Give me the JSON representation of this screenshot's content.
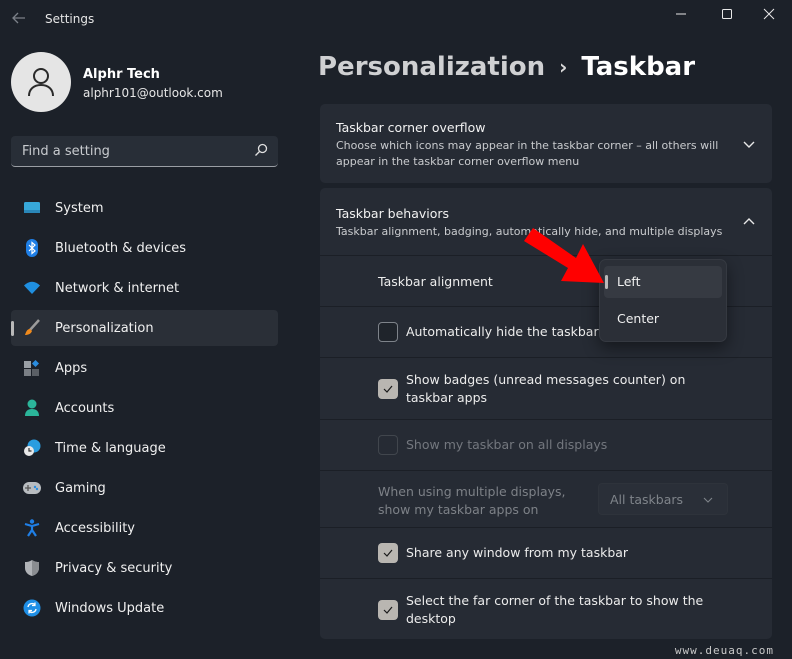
{
  "window": {
    "title": "Settings",
    "back_icon": "arrow-left",
    "controls": [
      "minimize",
      "maximize",
      "close"
    ]
  },
  "profile": {
    "name": "Alphr Tech",
    "email": "alphr101@outlook.com",
    "avatar_icon": "person"
  },
  "search": {
    "placeholder": "Find a setting",
    "value": "",
    "icon": "search"
  },
  "nav": {
    "items": [
      {
        "label": "System",
        "icon": "monitor",
        "active": false
      },
      {
        "label": "Bluetooth & devices",
        "icon": "bluetooth",
        "active": false
      },
      {
        "label": "Network & internet",
        "icon": "wifi",
        "active": false
      },
      {
        "label": "Personalization",
        "icon": "brush",
        "active": true
      },
      {
        "label": "Apps",
        "icon": "apps",
        "active": false
      },
      {
        "label": "Accounts",
        "icon": "person",
        "active": false
      },
      {
        "label": "Time & language",
        "icon": "globe-clock",
        "active": false
      },
      {
        "label": "Gaming",
        "icon": "gamepad",
        "active": false
      },
      {
        "label": "Accessibility",
        "icon": "accessibility",
        "active": false
      },
      {
        "label": "Privacy & security",
        "icon": "shield",
        "active": false
      },
      {
        "label": "Windows Update",
        "icon": "refresh",
        "active": false
      }
    ]
  },
  "header": {
    "parent": "Personalization",
    "separator": "›",
    "current": "Taskbar"
  },
  "cards": {
    "overflow": {
      "title": "Taskbar corner overflow",
      "subtitle": "Choose which icons may appear in the taskbar corner – all others will appear in the taskbar corner overflow menu",
      "expanded": false
    },
    "behaviors": {
      "title": "Taskbar behaviors",
      "subtitle": "Taskbar alignment, badging, automatically hide, and multiple displays",
      "expanded": true,
      "alignment_label": "Taskbar alignment",
      "auto_hide": {
        "label": "Automatically hide the taskbar",
        "checked": false,
        "enabled": true
      },
      "badges": {
        "label": "Show badges (unread messages counter) on taskbar apps",
        "checked": true,
        "enabled": true
      },
      "all_displays": {
        "label": "Show my taskbar on all displays",
        "checked": false,
        "enabled": false
      },
      "multi_display": {
        "label": "When using multiple displays, show my taskbar apps on",
        "value": "All taskbars",
        "enabled": false
      },
      "share_window": {
        "label": "Share any window from my taskbar",
        "checked": true,
        "enabled": true
      },
      "far_corner": {
        "label": "Select the far corner of the taskbar to show the desktop",
        "checked": true,
        "enabled": true
      }
    }
  },
  "alignment_flyout": {
    "options": [
      "Left",
      "Center"
    ],
    "selected": "Left"
  },
  "annotation": {
    "type": "arrow",
    "color": "#ff0000",
    "points_to": "alignment_flyout.Left"
  },
  "watermark": "www.deuaq.com"
}
